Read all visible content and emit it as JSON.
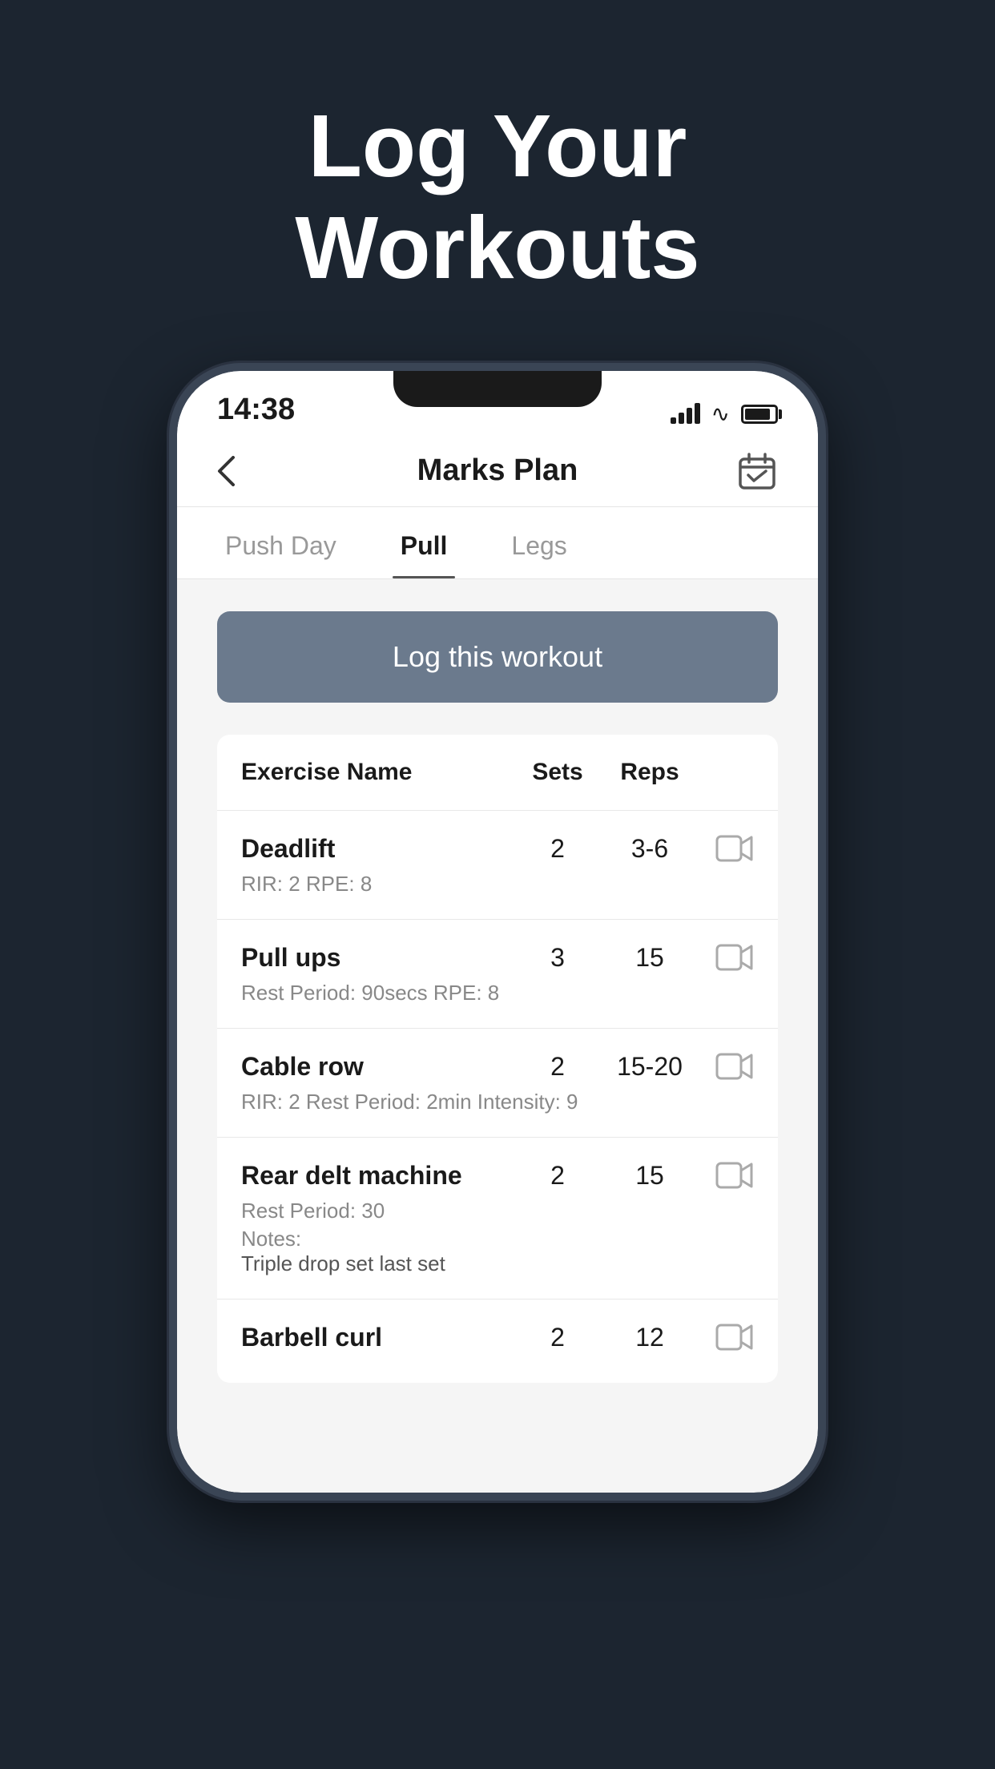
{
  "hero": {
    "title_line1": "Log Your",
    "title_line2": "Workouts"
  },
  "status_bar": {
    "time": "14:38",
    "signal_bars": [
      8,
      14,
      20,
      26
    ],
    "battery_percent": 85
  },
  "nav": {
    "back_icon": "chevron-left",
    "title": "Marks Plan",
    "calendar_icon": "calendar-check"
  },
  "tabs": [
    {
      "label": "Push Day",
      "active": false
    },
    {
      "label": "Pull",
      "active": true
    },
    {
      "label": "Legs",
      "active": false
    }
  ],
  "log_button": {
    "label": "Log this workout"
  },
  "table": {
    "headers": {
      "name": "Exercise Name",
      "sets": "Sets",
      "reps": "Reps"
    },
    "exercises": [
      {
        "name": "Deadlift",
        "sets": "2",
        "reps": "3-6",
        "has_video": true,
        "details": "RIR: 2   RPE: 8",
        "notes": null
      },
      {
        "name": "Pull ups",
        "sets": "3",
        "reps": "15",
        "has_video": true,
        "details": "Rest Period: 90secs   RPE: 8",
        "notes": null
      },
      {
        "name": "Cable row",
        "sets": "2",
        "reps": "15-20",
        "has_video": true,
        "details": "RIR: 2   Rest Period: 2min   Intensity: 9",
        "notes": null
      },
      {
        "name": "Rear delt machine",
        "sets": "2",
        "reps": "15",
        "has_video": true,
        "details": "Rest Period: 30",
        "notes": "Triple drop set last set"
      },
      {
        "name": "Barbell curl",
        "sets": "2",
        "reps": "12",
        "has_video": true,
        "details": null,
        "notes": null
      }
    ]
  }
}
